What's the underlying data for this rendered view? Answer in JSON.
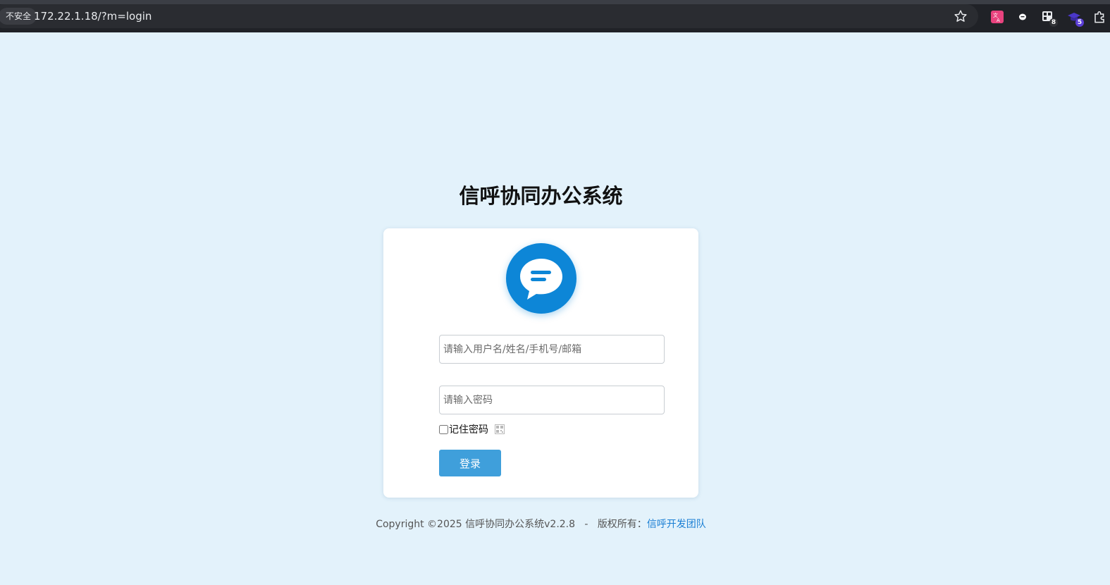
{
  "browser": {
    "security_label": "不安全",
    "url": "172.22.1.18/?m=login",
    "extensions": [
      {
        "icon": "translate-icon",
        "badge": ""
      },
      {
        "icon": "chat-bubble-icon",
        "badge": ""
      },
      {
        "icon": "extension-grid-icon",
        "badge": "8"
      },
      {
        "icon": "graduation-cap-icon",
        "badge": "5"
      },
      {
        "icon": "puzzle-icon",
        "badge": ""
      }
    ]
  },
  "page": {
    "title": "信呼协同办公系统"
  },
  "login": {
    "logo_icon": "chat-bubble-logo-icon",
    "username_placeholder": "请输入用户名/姓名/手机号/邮箱",
    "username_value": "",
    "password_placeholder": "请输入密码",
    "password_value": "",
    "remember_label": "记住密码",
    "remember_checked": false,
    "submit_label": "登录"
  },
  "footer": {
    "copyright": "Copyright ©2025 信呼协同办公系统v2.2.8",
    "separator": "-",
    "rights_label": "版权所有：",
    "team_link": "信呼开发团队"
  },
  "colors": {
    "page_bg": "#e3f2fb",
    "brand_blue": "#0d86d7",
    "button_blue": "#3f9fdb",
    "link_blue": "#1a7fd4"
  }
}
